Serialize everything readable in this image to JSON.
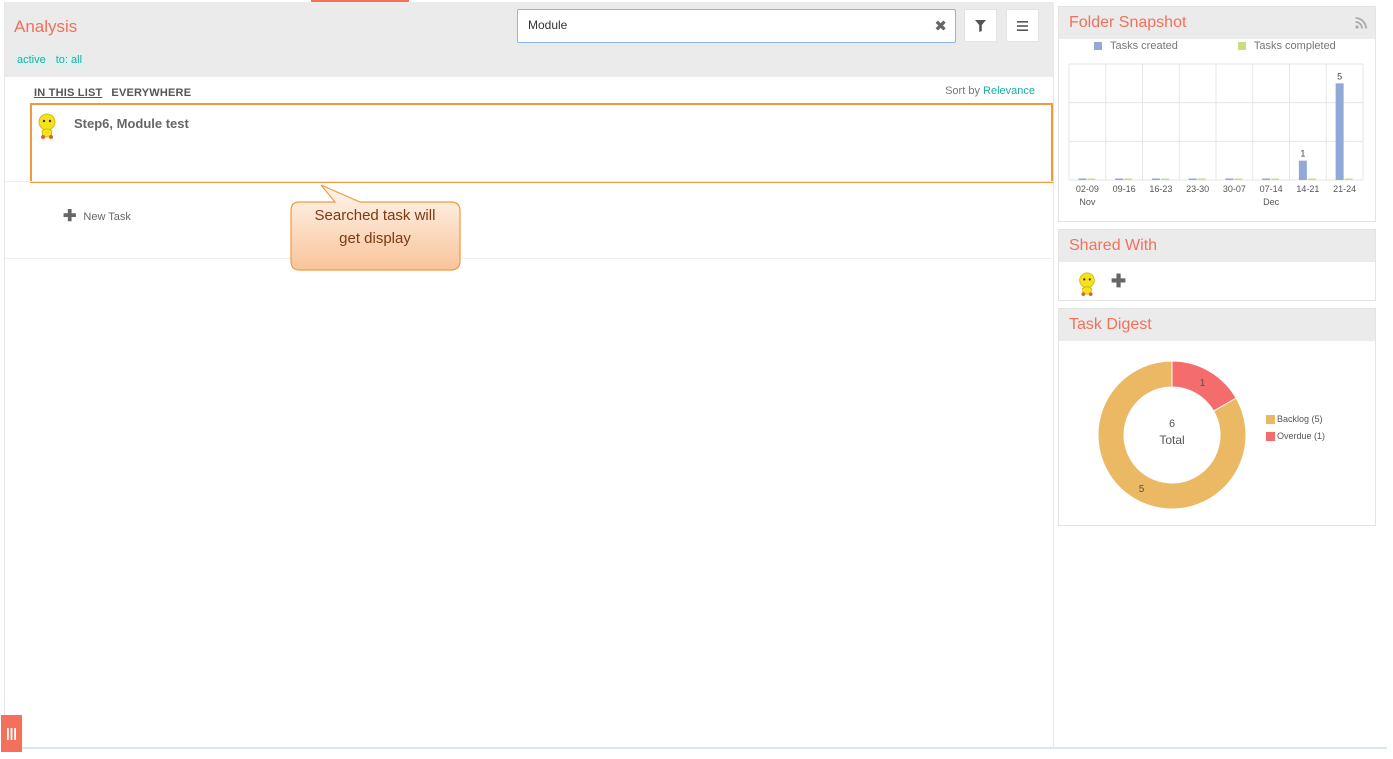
{
  "header": {
    "title": "Analysis",
    "tags": [
      "active",
      "to: all"
    ],
    "search": {
      "value": "Module",
      "placeholder": ""
    }
  },
  "scope": {
    "tabs": [
      "IN THIS LIST",
      "EVERYWHERE"
    ],
    "active": "IN THIS LIST"
  },
  "sort": {
    "prefix": "Sort by",
    "value": "Relevance"
  },
  "tasks": [
    {
      "title": "Step6, Module test"
    }
  ],
  "new_task_label": "New Task",
  "callout": {
    "lines": [
      "Searched task will",
      "get display"
    ]
  },
  "sidebar": {
    "snapshot_title": "Folder Snapshot",
    "shared_title": "Shared With",
    "digest_title": "Task Digest"
  },
  "colors": {
    "accent": "#f4705a",
    "teal": "#1aafa0",
    "created": "#92a9d8",
    "completed": "#c9de7e",
    "backlog": "#ebb964",
    "overdue": "#f46c6c"
  },
  "chart_data": [
    {
      "type": "bar",
      "categories": [
        "02-09",
        "09-16",
        "16-23",
        "23-30",
        "30-07",
        "07-14",
        "14-21",
        "21-24"
      ],
      "category_sublabels": [
        "Nov",
        "",
        "",
        "",
        "",
        "Dec",
        "",
        ""
      ],
      "series": [
        {
          "name": "Tasks created",
          "values": [
            0,
            0,
            0,
            0,
            0,
            0,
            1,
            5
          ]
        },
        {
          "name": "Tasks completed",
          "values": [
            0,
            0,
            0,
            0,
            0,
            0,
            0,
            0
          ]
        }
      ],
      "data_labels": [
        "",
        "",
        "",
        "",
        "",
        "",
        "1",
        "5"
      ],
      "ylim": [
        0,
        6
      ],
      "grid": true,
      "legend": "top"
    },
    {
      "type": "pie",
      "variant": "donut",
      "labels": [
        "Backlog",
        "Overdue"
      ],
      "legend_labels": [
        "Backlog (5)",
        "Overdue (1)"
      ],
      "values": [
        5,
        1
      ],
      "center_value": "6",
      "center_label": "Total",
      "legend": "right"
    }
  ]
}
